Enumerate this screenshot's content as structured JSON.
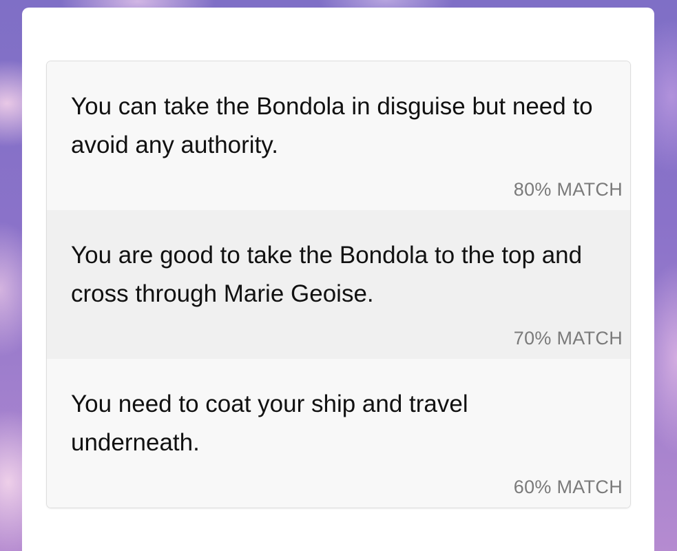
{
  "results": [
    {
      "text": "You can take the Bondola in disguise but need to avoid any authority.",
      "match": "80% MATCH"
    },
    {
      "text": "You are good to take the Bondola to the top and cross through Marie Geoise.",
      "match": "70% MATCH"
    },
    {
      "text": "You need to coat your ship and travel underneath.",
      "match": "60% MATCH"
    }
  ]
}
